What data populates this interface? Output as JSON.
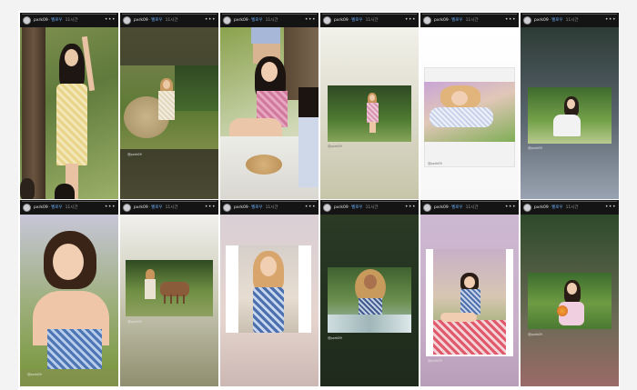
{
  "stories": [
    {
      "username": "pxrk09",
      "tag": "벨로우",
      "time": "11시간",
      "caption": "",
      "bg": "linear-gradient(#3b4d2c,#5c7a3e)",
      "photo_bg": "linear-gradient(160deg,#7e8f4f 0%,#5f7a3c 40%,#9bb068 100%)"
    },
    {
      "username": "pxrk09",
      "tag": "벨로우",
      "time": "11시간",
      "caption": "@pxrk09",
      "bg": "linear-gradient(#4a4b32,#3e3f2a 70%,#4b4a33)",
      "photo_bg": "linear-gradient(180deg,#6f7f47 0%,#5d7a34 55%,#7c8c48 100%)"
    },
    {
      "username": "pxrk09",
      "tag": "벨로우",
      "time": "11시간",
      "caption": "",
      "bg": "linear-gradient(#6c8a3e,#8fae55)",
      "photo_bg": "linear-gradient(160deg,#8aa24d 0%,#cfd7b5 60%,#e9e2d8 100%)"
    },
    {
      "username": "pxrk09",
      "tag": "벨로우",
      "time": "11시간",
      "caption": "@pxrk09",
      "bg": "linear-gradient(#f2f1ea,#d8d6c4 60%,#c7c5a9)",
      "photo_bg": "linear-gradient(180deg,#2f4a24 0%,#4e7a31 60%,#86a45a 100%)"
    },
    {
      "username": "pxrk09",
      "tag": "벨로우",
      "time": "11시간",
      "caption": "@pxrk09",
      "bg": "linear-gradient(#ffffff,#f7f7f7)",
      "photo_bg": "linear-gradient(160deg,#c8a5d6 0%,#e1c7b8 45%,#7fae55 100%)"
    },
    {
      "username": "pxrk09",
      "tag": "벨로우",
      "time": "11시간",
      "caption": "@pxrk09",
      "bg": "linear-gradient(#2d3b35,#5b6670 55%,#9aa3b1)",
      "photo_bg": "linear-gradient(180deg,#3f6a2d 0%,#74a24a 60%,#b9c98f 100%)"
    },
    {
      "username": "pxrk09",
      "tag": "벨로우",
      "time": "11시간",
      "caption": "@pxrk09",
      "bg": "linear-gradient(#c9c4d6,#8f9b5c 60%,#7f9248)",
      "photo_bg": "linear-gradient(180deg,#c7c6d8 0%,#9fb080 55%,#7d9a45 100%)"
    },
    {
      "username": "pxrk09",
      "tag": "벨로우",
      "time": "11시간",
      "caption": "@pxrk09",
      "bg": "linear-gradient(#f1f0ec,#c9c8b4 50%,#8f8e6f)",
      "photo_bg": "linear-gradient(180deg,#2f4a22 0%,#6f8f43 55%,#8ea05f 100%)"
    },
    {
      "username": "pxrk09",
      "tag": "벨로우",
      "time": "11시간",
      "caption": "",
      "bg": "linear-gradient(#d9cfd5,#e6d5cf 60%,#cbb7b3)",
      "photo_bg": "linear-gradient(180deg,#d6cfc9 0%,#e7ddd2 60%,#c9c0b1 100%)"
    },
    {
      "username": "pxrk09",
      "tag": "벨로우",
      "time": "11시간",
      "caption": "@pxrk09",
      "bg": "linear-gradient(#2a3a25,#22301f 60%,#1f2a1d)",
      "photo_bg": "linear-gradient(180deg,#3f6130 0%,#6a8e4d 50%,#a9c0bf 100%)"
    },
    {
      "username": "pxrk09",
      "tag": "벨로우",
      "time": "11시간",
      "caption": "@pxrk09",
      "bg": "linear-gradient(#cdb8d2,#c9b0c9 60%,#b99eb9)",
      "photo_bg": "linear-gradient(180deg,#c8b0c8 0%,#d7c6b2 45%,#7aa04a 100%)"
    },
    {
      "username": "pxrk09",
      "tag": "벨로우",
      "time": "11시간",
      "caption": "@pxrk09",
      "bg": "linear-gradient(#2e4a2a,#6a6a55 60%,#9a6a68)",
      "photo_bg": "linear-gradient(180deg,#3c6d2d 0%,#6e9b43 55%,#4a7a33 100%)"
    }
  ]
}
